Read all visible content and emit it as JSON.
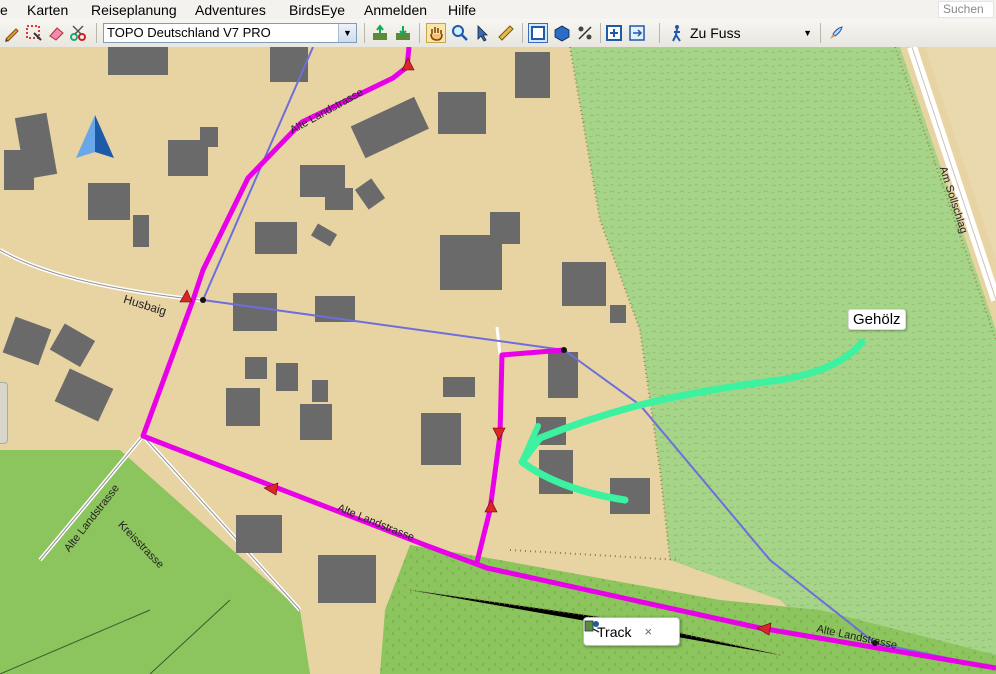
{
  "menu": {
    "items": [
      "e",
      "Karten",
      "Reiseplanung",
      "Adventures",
      "BirdsEye",
      "Anmelden",
      "Hilfe"
    ],
    "search_placeholder": "Suchen"
  },
  "toolbar": {
    "map_product": "TOPO Deutschland V7 PRO",
    "travel_mode": "Zu Fuss"
  },
  "map": {
    "street_labels": {
      "alte_landstrasse_top": "Alte Landstrasse",
      "husbaig": "Husbaig",
      "alte_landstrasse_mid": "Alte Landstrasse",
      "alte_landstrasse_left": "Alte Landstrasse",
      "kreisstrasse": "Kreisstrasse",
      "am_sollschlag": "Am Sollschlag",
      "alte_landstrasse_bottom": "Alte Landstrasse"
    },
    "poi_label": "Gehölz",
    "track_popup": "Track"
  },
  "colors": {
    "route": "#e800e8",
    "track": "#3cf2a0",
    "link_line": "#6e6edc",
    "forest": "#a6d488",
    "meadow": "#8cc45e",
    "ground": "#e8d3a3",
    "building": "#6a6a6a"
  }
}
